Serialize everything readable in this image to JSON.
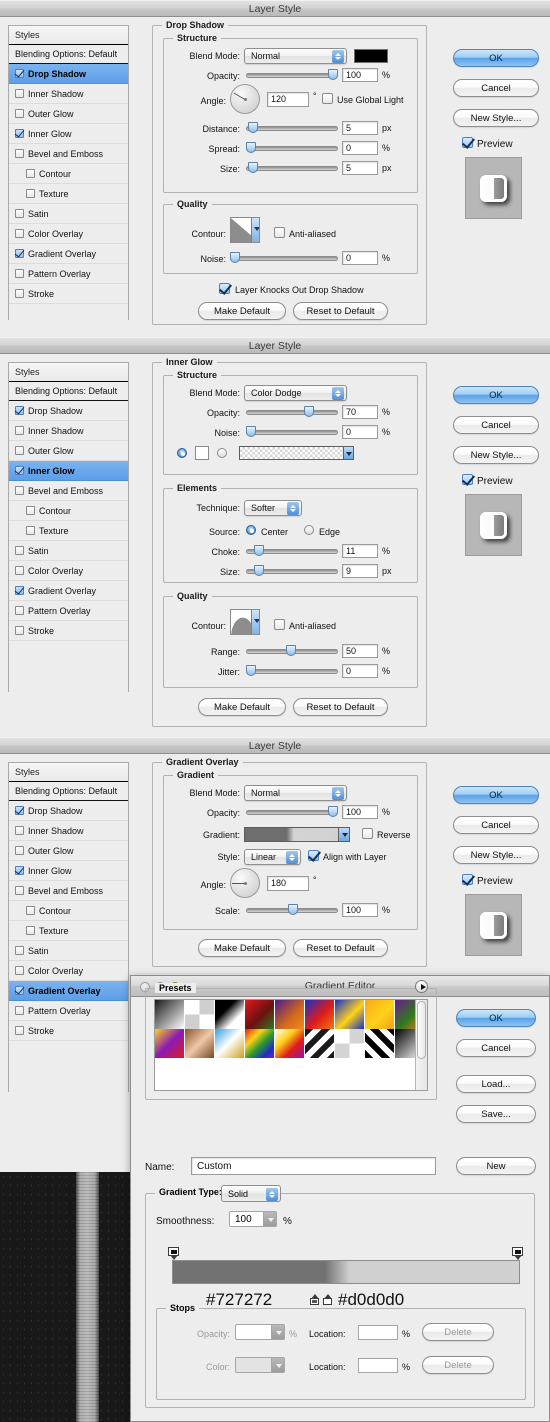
{
  "window_title": "Layer Style",
  "styles_panel": {
    "header": "Styles",
    "blending_options": "Blending Options: Default",
    "items": [
      {
        "label": "Drop Shadow",
        "checked": true,
        "indent": false
      },
      {
        "label": "Inner Shadow",
        "checked": false,
        "indent": false
      },
      {
        "label": "Outer Glow",
        "checked": false,
        "indent": false
      },
      {
        "label": "Inner Glow",
        "checked": true,
        "indent": false
      },
      {
        "label": "Bevel and Emboss",
        "checked": false,
        "indent": false
      },
      {
        "label": "Contour",
        "checked": false,
        "indent": true
      },
      {
        "label": "Texture",
        "checked": false,
        "indent": true
      },
      {
        "label": "Satin",
        "checked": false,
        "indent": false
      },
      {
        "label": "Color Overlay",
        "checked": false,
        "indent": false
      },
      {
        "label": "Gradient Overlay",
        "checked": true,
        "indent": false
      },
      {
        "label": "Pattern Overlay",
        "checked": false,
        "indent": false
      },
      {
        "label": "Stroke",
        "checked": false,
        "indent": false
      }
    ]
  },
  "buttons": {
    "ok": "OK",
    "cancel": "Cancel",
    "new_style": "New Style...",
    "preview": "Preview",
    "make_default": "Make Default",
    "reset_to_default": "Reset to Default"
  },
  "panel1": {
    "section_title": "Drop Shadow",
    "structure_title": "Structure",
    "quality_title": "Quality",
    "blend_mode_label": "Blend Mode:",
    "blend_mode_value": "Normal",
    "shadow_color": "#000000",
    "opacity_label": "Opacity:",
    "opacity_value": "100",
    "opacity_unit": "%",
    "angle_label": "Angle:",
    "angle_value": "120",
    "angle_unit": "°",
    "use_global_light": "Use Global Light",
    "use_global_light_checked": false,
    "distance_label": "Distance:",
    "distance_value": "5",
    "distance_unit": "px",
    "spread_label": "Spread:",
    "spread_value": "0",
    "spread_unit": "%",
    "size_label": "Size:",
    "size_value": "5",
    "size_unit": "px",
    "contour_label": "Contour:",
    "anti_aliased": "Anti-aliased",
    "anti_aliased_checked": false,
    "noise_label": "Noise:",
    "noise_value": "0",
    "noise_unit": "%",
    "knocks_out": "Layer Knocks Out Drop Shadow",
    "knocks_out_checked": true
  },
  "panel2": {
    "section_title": "Inner Glow",
    "structure_title": "Structure",
    "elements_title": "Elements",
    "quality_title": "Quality",
    "blend_mode_label": "Blend Mode:",
    "blend_mode_value": "Color Dodge",
    "opacity_label": "Opacity:",
    "opacity_value": "70",
    "opacity_unit": "%",
    "noise_label": "Noise:",
    "noise_value": "0",
    "noise_unit": "%",
    "technique_label": "Technique:",
    "technique_value": "Softer",
    "source_label": "Source:",
    "source_center": "Center",
    "source_edge": "Edge",
    "source_selected": "Center",
    "choke_label": "Choke:",
    "choke_value": "11",
    "choke_unit": "%",
    "size_label": "Size:",
    "size_value": "9",
    "size_unit": "px",
    "contour_label": "Contour:",
    "anti_aliased": "Anti-aliased",
    "anti_aliased_checked": false,
    "range_label": "Range:",
    "range_value": "50",
    "range_unit": "%",
    "jitter_label": "Jitter:",
    "jitter_value": "0",
    "jitter_unit": "%"
  },
  "panel3": {
    "section_title": "Gradient Overlay",
    "gradient_title": "Gradient",
    "blend_mode_label": "Blend Mode:",
    "blend_mode_value": "Normal",
    "opacity_label": "Opacity:",
    "opacity_value": "100",
    "opacity_unit": "%",
    "gradient_label": "Gradient:",
    "reverse_label": "Reverse",
    "reverse_checked": false,
    "style_label": "Style:",
    "style_value": "Linear",
    "align_with_layer": "Align with Layer",
    "align_with_layer_checked": true,
    "angle_label": "Angle:",
    "angle_value": "180",
    "angle_unit": "°",
    "scale_label": "Scale:",
    "scale_value": "100",
    "scale_unit": "%"
  },
  "gradient_editor": {
    "title": "Gradient Editor",
    "presets_label": "Presets",
    "ok": "OK",
    "cancel": "Cancel",
    "load": "Load...",
    "save": "Save...",
    "new": "New",
    "name_label": "Name:",
    "name_value": "Custom",
    "gradient_type_label": "Gradient Type:",
    "gradient_type_value": "Solid",
    "smoothness_label": "Smoothness:",
    "smoothness_value": "100",
    "smoothness_unit": "%",
    "stops_label": "Stops",
    "opacity_label": "Opacity:",
    "opacity_value": "",
    "opacity_unit": "%",
    "color_label": "Color:",
    "color_value": "",
    "location_label": "Location:",
    "location_value_1": "",
    "location_value_2": "",
    "location_unit": "%",
    "delete_label": "Delete",
    "stop_color_left": "#727272",
    "stop_color_right": "#d0d0d0",
    "presets": [
      "linear-gradient(135deg,#1a1a1a,#ffffff)",
      "repeating-conic-gradient(#cfcfcf 0 25%,#ffffff 0 50%)",
      "linear-gradient(135deg,#000000 0%,#000000 35%,#ffffff 70%)",
      "linear-gradient(135deg,#e01b1b,#6b1010 55%,#2e7a1e)",
      "linear-gradient(135deg,#4b1a8a,#d46a1a 60%,#f08a20)",
      "linear-gradient(135deg,#1c2fc0,#e01b1b 55%,#f07a10)",
      "linear-gradient(135deg,#1530c8 0%,#ffd21a 55%,#1530c8 100%)",
      "linear-gradient(135deg,#f7a81b,#ffd21a 55%,#f0a11a)",
      "linear-gradient(135deg,#6a1a8a,#2e7a1e 55%,#f07a10)",
      "linear-gradient(135deg,#ffd21a,#8a1ab5 50%,#e01b1b)",
      "linear-gradient(135deg,#8a5530,#f0c8a8 50%,#7a4526)",
      "linear-gradient(135deg,#2f9fe0 0%,#ffffff 48%,#c9a01a 100%)",
      "linear-gradient(135deg,#e01b1b,#ffd21a 30%,#2e9a2e 55%,#1c2fc0 80%,#8a1ab5)",
      "linear-gradient(135deg,#ffffff,#ffd21a 35%,#e01b1b 65%,#8a1ab5)",
      "repeating-linear-gradient(135deg,#1a1a1a 0 6px,#ffffff 6px 12px)",
      "repeating-conic-gradient(#d4d4d4 0 25%,#ffffff 0 50%)",
      "repeating-linear-gradient(45deg,#000000 0 6px,#ffffff 6px 12px)",
      "linear-gradient(135deg,#000000,#ffffff)"
    ]
  }
}
